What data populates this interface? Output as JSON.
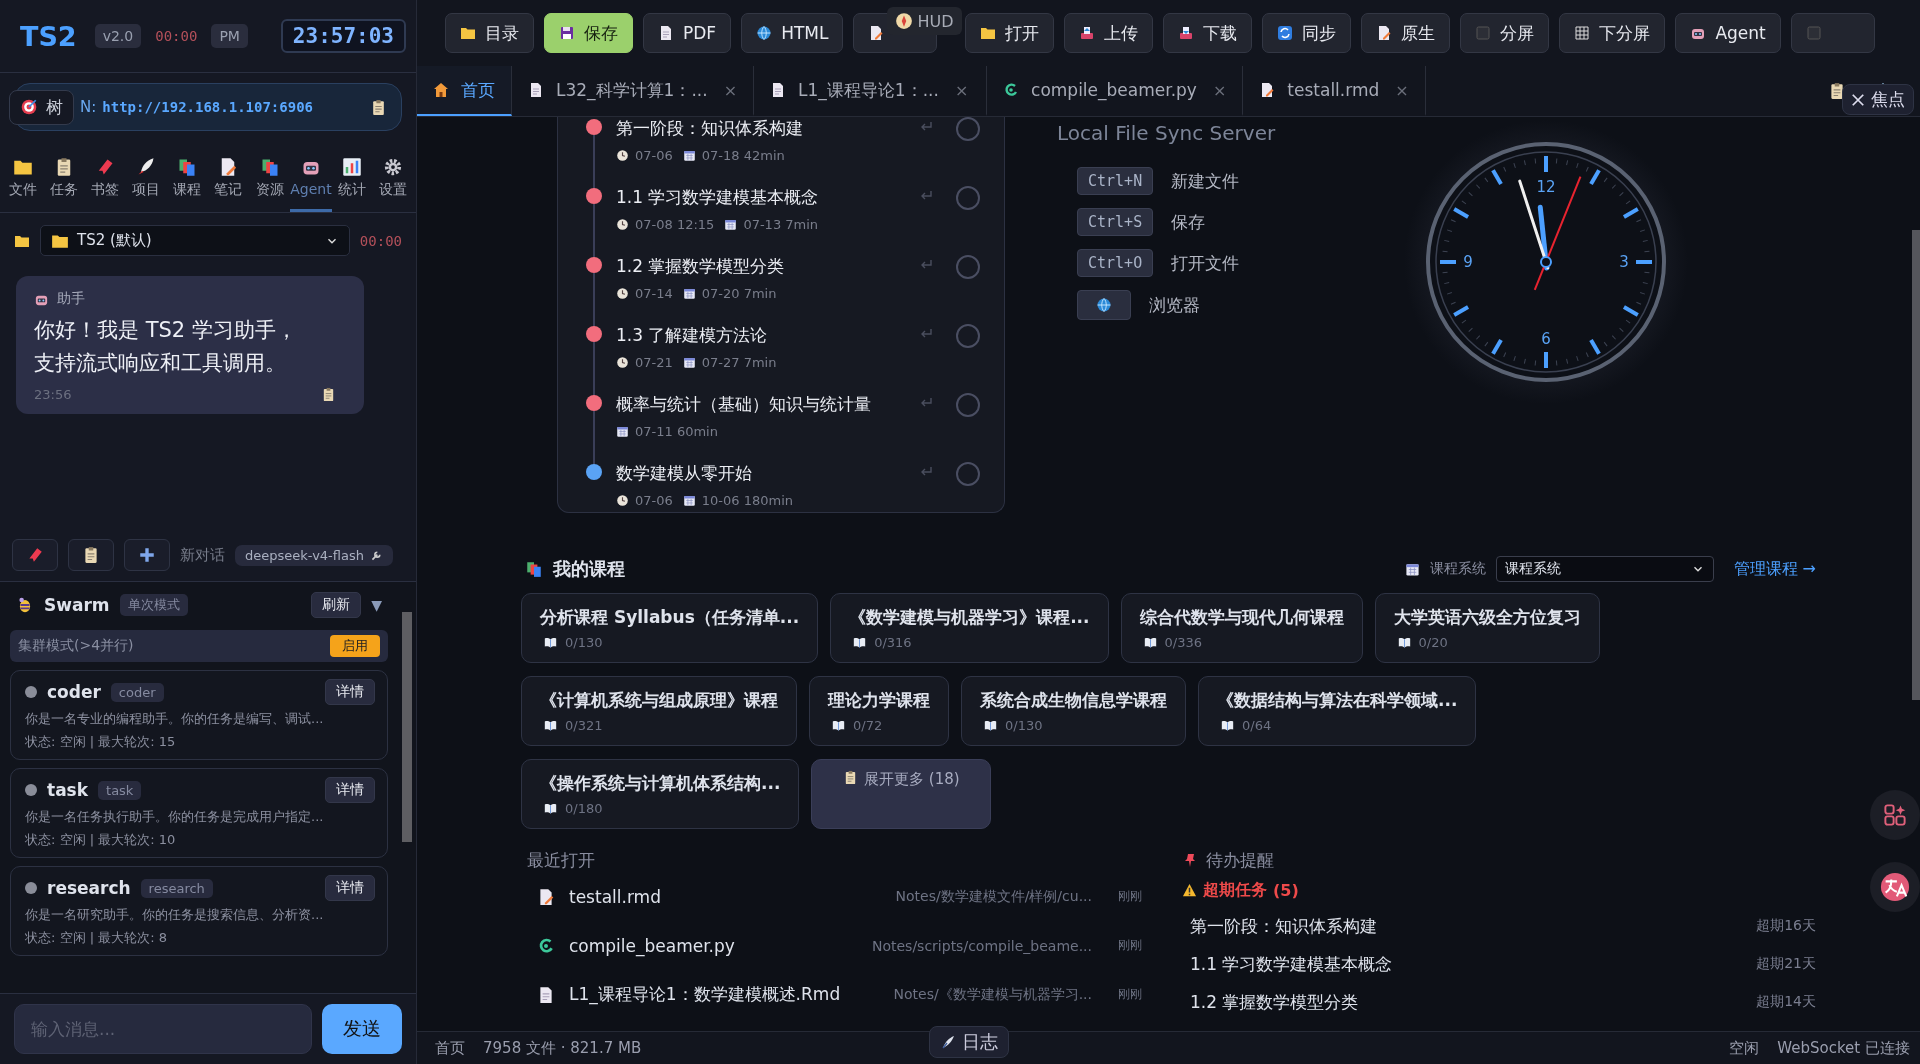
{
  "sidebar": {
    "brand": "TS2",
    "version": "v2.0",
    "timer": "00:00",
    "ampm": "PM",
    "clock": "23:57:03",
    "server": {
      "tree_label": "树",
      "prefix": "N:",
      "url": "http://192.168.1.107:6906"
    },
    "nav": [
      {
        "label": "文件",
        "selected": false
      },
      {
        "label": "任务",
        "selected": false
      },
      {
        "label": "书签",
        "selected": false
      },
      {
        "label": "项目",
        "selected": false
      },
      {
        "label": "课程",
        "selected": false
      },
      {
        "label": "笔记",
        "selected": false
      },
      {
        "label": "资源",
        "selected": false
      },
      {
        "label": "Agent",
        "selected": true
      },
      {
        "label": "统计",
        "selected": false
      },
      {
        "label": "设置",
        "selected": false
      }
    ],
    "workspace": {
      "value": "TS2 (默认)",
      "timer": "00:00"
    },
    "chat": [
      {
        "sender": "助手",
        "text": "你好！我是 TS2 学习助手，支持流式响应和工具调用。",
        "time": "23:56"
      }
    ],
    "chat_toolbar": {
      "new_chat": "新对话",
      "model": "deepseek-v4-flash"
    },
    "swarm": {
      "title": "Swarm",
      "mode": "单次模式",
      "refresh": "刷新",
      "toggle": "▼",
      "cluster": {
        "label": "集群模式(>4并行)",
        "action": "启用"
      },
      "agents": [
        {
          "name": "coder",
          "tag": "coder",
          "action": "详情",
          "description": "你是一名专业的编程助手。你的任务是编写、调试...",
          "status": "状态: 空闲 | 最大轮次: 15",
          "color": "#8a8d99"
        },
        {
          "name": "task",
          "tag": "task",
          "action": "详情",
          "description": "你是一名任务执行助手。你的任务是完成用户指定...",
          "status": "状态: 空闲 | 最大轮次: 10",
          "color": "#8a8d99"
        },
        {
          "name": "research",
          "tag": "research",
          "action": "详情",
          "description": "你是一名研究助手。你的任务是搜索信息、分析资...",
          "status": "状态: 空闲 | 最大轮次: 8",
          "color": "#8a8d99"
        }
      ]
    },
    "input": {
      "placeholder": "输入消息...",
      "send": "发送"
    }
  },
  "toolbar": [
    {
      "label": "目录",
      "selected": false
    },
    {
      "label": "保存",
      "selected": true
    },
    {
      "label": "PDF",
      "selected": false
    },
    {
      "label": "HTML",
      "selected": false
    },
    {
      "selected": false
    },
    {
      "label": "打开",
      "selected": false
    },
    {
      "label": "上传",
      "selected": false
    },
    {
      "label": "下载",
      "selected": false
    },
    {
      "label": "同步",
      "selected": false
    },
    {
      "label": "原生",
      "selected": false
    },
    {
      "label": "分屏",
      "selected": false
    },
    {
      "label": "下分屏",
      "selected": false
    },
    {
      "label": "Agent",
      "selected": false
    },
    {
      "selected": false
    }
  ],
  "hud": "HUD",
  "tabs": [
    {
      "kind": "home",
      "label": "首页",
      "selected": true
    },
    {
      "kind": "doc",
      "label": "L32_科学计算1：...",
      "selected": false,
      "close": "×"
    },
    {
      "kind": "doc",
      "label": "L1_课程导论1：...",
      "selected": false,
      "close": "×"
    },
    {
      "kind": "py",
      "label": "compile_beamer.py",
      "selected": false,
      "close": "×"
    },
    {
      "kind": "rmd",
      "label": "testall.rmd",
      "selected": false,
      "close": "×"
    }
  ],
  "focus_button": "焦点",
  "timeline": [
    {
      "title": "第一阶段：知识体系构建",
      "color": "#f26d7d",
      "checked": false,
      "meta": [
        {
          "kind": "clock",
          "text": "07-06"
        },
        {
          "kind": "calendar",
          "text": "07-18 42min"
        }
      ]
    },
    {
      "title": "1.1 学习数学建模基本概念",
      "color": "#f26d7d",
      "checked": false,
      "meta": [
        {
          "kind": "clock",
          "text": "07-08 12:15"
        },
        {
          "kind": "calendar",
          "text": "07-13 7min"
        }
      ]
    },
    {
      "title": "1.2 掌握数学模型分类",
      "color": "#f26d7d",
      "checked": false,
      "meta": [
        {
          "kind": "clock",
          "text": "07-14"
        },
        {
          "kind": "calendar",
          "text": "07-20 7min"
        }
      ]
    },
    {
      "title": "1.3 了解建模方法论",
      "color": "#f26d7d",
      "checked": false,
      "meta": [
        {
          "kind": "clock",
          "text": "07-21"
        },
        {
          "kind": "calendar",
          "text": "07-27 7min"
        }
      ]
    },
    {
      "title": "概率与统计（基础）知识与统计量",
      "color": "#f26d7d",
      "checked": false,
      "meta": [
        {
          "kind": "calendar",
          "text": "07-11 60min"
        }
      ]
    },
    {
      "title": "数学建模从零开始",
      "color": "#5aa3f5",
      "checked": false,
      "meta": [
        {
          "kind": "clock",
          "text": "07-06"
        },
        {
          "kind": "calendar",
          "text": "10-06 180min"
        }
      ]
    }
  ],
  "sync_server": {
    "title": "Local File Sync Server",
    "shortcuts": [
      {
        "kind": "key",
        "key": "Ctrl+N",
        "label": "新建文件"
      },
      {
        "kind": "key",
        "key": "Ctrl+S",
        "label": "保存"
      },
      {
        "kind": "key",
        "key": "Ctrl+O",
        "label": "打开文件"
      },
      {
        "kind": "icon",
        "label": "浏览器"
      }
    ]
  },
  "clock": {
    "numerals": [
      "12",
      "3",
      "6",
      "9"
    ]
  },
  "courses": {
    "title": "我的课程",
    "system_label": "课程系统",
    "system_value": "课程系统",
    "manage": "管理课程 →",
    "items": [
      {
        "title": "分析课程 Syllabus（任务清单...",
        "progress": "0/130"
      },
      {
        "title": "《数学建模与机器学习》课程...",
        "progress": "0/316"
      },
      {
        "title": "综合代数学与现代几何课程",
        "progress": "0/336"
      },
      {
        "title": "大学英语六级全方位复习",
        "progress": "0/20"
      },
      {
        "title": "《计算机系统与组成原理》课程",
        "progress": "0/321"
      },
      {
        "title": "理论力学课程",
        "progress": "0/72"
      },
      {
        "title": "系统合成生物信息学课程",
        "progress": "0/130"
      },
      {
        "title": "《数据结构与算法在科学领域...",
        "progress": "0/64"
      },
      {
        "title": "《操作系统与计算机体系结构...",
        "progress": "0/180"
      }
    ],
    "more": "展开更多 (18)"
  },
  "recent": {
    "title": "最近打开",
    "items": [
      {
        "kind": "rmd",
        "name": "testall.rmd",
        "path": "Notes/数学建模文件/样例/cu...",
        "time": "刚刚"
      },
      {
        "kind": "py",
        "name": "compile_beamer.py",
        "path": "Notes/scripts/compile_beame...",
        "time": "刚刚"
      },
      {
        "kind": "doc",
        "name": "L1_课程导论1：数学建模概述.Rmd",
        "path": "Notes/《数学建模与机器学习...",
        "time": "刚刚"
      }
    ]
  },
  "todo": {
    "title": "待办提醒",
    "overdue_label": "超期任务",
    "overdue_count": "(5)",
    "items": [
      {
        "title": "第一阶段：知识体系构建",
        "due": "超期16天"
      },
      {
        "title": "1.1 学习数学建模基本概念",
        "due": "超期21天"
      },
      {
        "title": "1.2 掌握数学模型分类",
        "due": "超期14天"
      }
    ]
  },
  "log_button": "日志",
  "status_bar": {
    "page": "首页",
    "files": "7958 文件 · 821.7 MB",
    "state": "空闲",
    "connection": "WebSocket 已连接"
  }
}
